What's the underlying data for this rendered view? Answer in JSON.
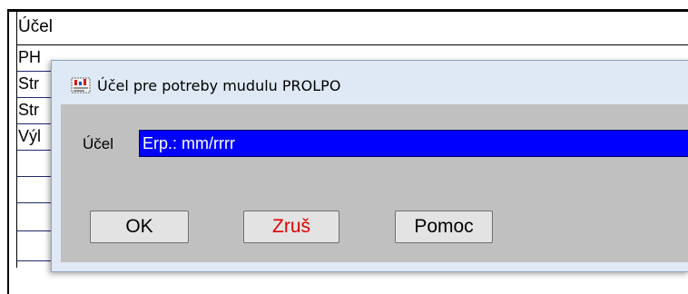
{
  "grid": {
    "header": "Účel",
    "rows": [
      "PH",
      "Str",
      "Str",
      "Výl",
      "",
      "",
      "",
      ""
    ]
  },
  "dialog": {
    "title": "Účel pre potreby mudulu PROLPO",
    "icon": "app-icon",
    "field_label": "Účel",
    "field_value": "Erp.: mm/rrrr",
    "buttons": {
      "ok": "OK",
      "cancel": "Zruš",
      "help": "Pomoc"
    }
  },
  "colors": {
    "input_bg": "#0000ff",
    "cancel_text": "#e00000",
    "dialog_frame": "#dfe9f5",
    "client_bg": "#c0c0c0"
  }
}
